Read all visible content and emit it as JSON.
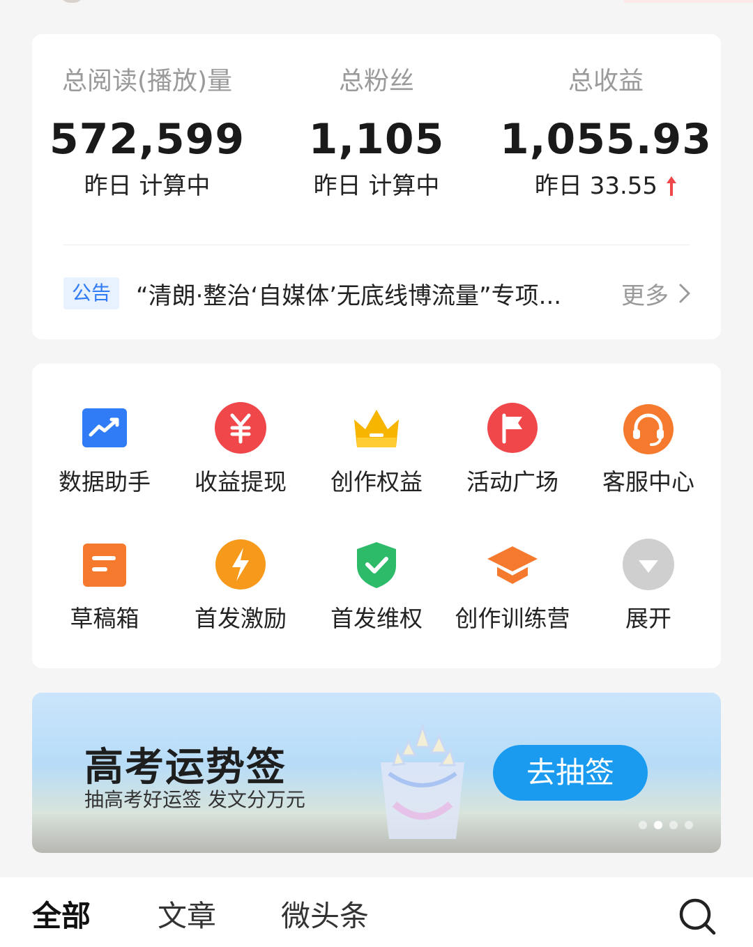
{
  "stats": [
    {
      "label": "总阅读(播放)量",
      "value": "572,599",
      "sub": "昨日 计算中"
    },
    {
      "label": "总粉丝",
      "value": "1,105",
      "sub": "昨日 计算中"
    },
    {
      "label": "总收益",
      "value": "1,055.93",
      "sub": "昨日 33.55"
    }
  ],
  "notice": {
    "badge": "公告",
    "text": "“清朗·整治‘自媒体’无底线博流量”专项...",
    "more": "更多"
  },
  "tools": [
    {
      "label": "数据助手",
      "icon": "chart-trend-icon",
      "color": "#2f7cf6"
    },
    {
      "label": "收益提现",
      "icon": "yuan-icon",
      "color": "#f0474b"
    },
    {
      "label": "创作权益",
      "icon": "crown-icon",
      "color": "#f7b500"
    },
    {
      "label": "活动广场",
      "icon": "flag-icon",
      "color": "#f0474b"
    },
    {
      "label": "客服中心",
      "icon": "headset-icon",
      "color": "#f57a2e"
    },
    {
      "label": "草稿箱",
      "icon": "draft-icon",
      "color": "#f57a2e"
    },
    {
      "label": "首发激励",
      "icon": "lightning-icon",
      "color": "#f79a1c"
    },
    {
      "label": "首发维权",
      "icon": "shield-check-icon",
      "color": "#2dbb6a"
    },
    {
      "label": "创作训练营",
      "icon": "graduation-cap-icon",
      "color": "#f57a2e"
    },
    {
      "label": "展开",
      "icon": "expand-icon",
      "color": "#c9c9c9"
    }
  ],
  "banner": {
    "title": "高考运势签",
    "subtitle": "抽高考好运签 发文分万元",
    "button": "去抽签",
    "slide_count": 4,
    "active_slide": 2
  },
  "tabs": [
    {
      "label": "全部",
      "active": true
    },
    {
      "label": "文章",
      "active": false
    },
    {
      "label": "微头条",
      "active": false
    }
  ],
  "colors": {
    "accent_blue": "#1a9bf0",
    "up_red": "#f0474b"
  }
}
